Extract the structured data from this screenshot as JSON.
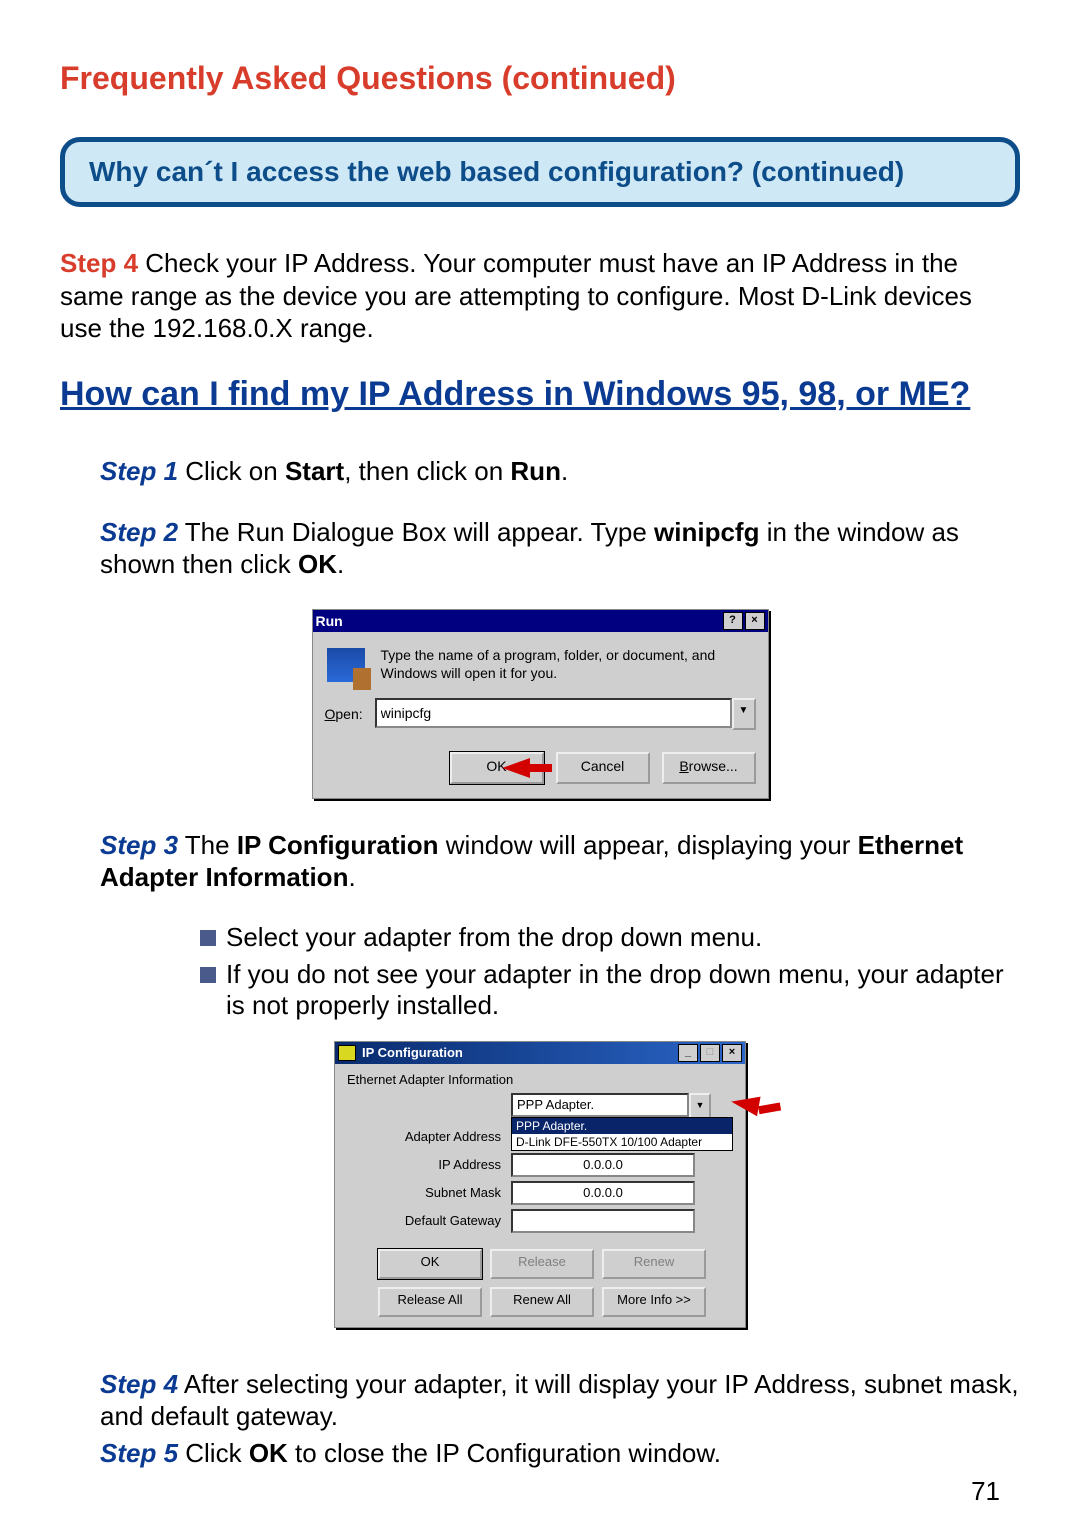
{
  "section_title": "Frequently Asked Questions (continued)",
  "faq_box": "Why can´t I access the web based configuration? (continued)",
  "top_step_label": "Step 4",
  "top_step_text": " Check your IP Address. Your computer must have an IP Address in the same range as the device you are attempting to configure. Most D-Link devices use the 192.168.0.X range.",
  "big_heading": "How can I find my IP Address in Windows 95, 98, or ME?",
  "step1_label": "Step 1",
  "step1_a": " Click on ",
  "step1_b": "Start",
  "step1_c": ", then click on ",
  "step1_d": "Run",
  "step1_e": ".",
  "step2_label": "Step 2",
  "step2_a": " The Run Dialogue Box will appear. Type ",
  "step2_b": "winipcfg",
  "step2_c": " in the window as shown then click ",
  "step2_d": "OK",
  "step2_e": ".",
  "run": {
    "title": "Run",
    "help": "?",
    "close": "×",
    "desc": "Type the name of a program, folder, or document, and Windows will open it for you.",
    "open_underline": "O",
    "open_rest": "pen:",
    "value": "winipcfg",
    "ok": "OK",
    "cancel": "Cancel",
    "browse_underline": "B",
    "browse_rest": "rowse..."
  },
  "step3_label": "Step 3",
  "step3_a": " The ",
  "step3_b": "IP Configuration",
  "step3_c": " window will appear, displaying your ",
  "step3_d": "Ethernet Adapter Information",
  "step3_e": ".",
  "bullets": [
    "Select your adapter from the drop down menu.",
    "If you do not see your adapter in the drop down menu, your adapter is not properly installed."
  ],
  "ip": {
    "title": "IP Configuration",
    "min": "_",
    "max": "□",
    "close": "×",
    "group": "Ethernet Adapter Information",
    "fields": {
      "adapter_selected": "PPP Adapter.",
      "options": [
        "PPP Adapter.",
        "D-Link DFE-550TX 10/100 Adapter"
      ],
      "adapter_address_label": "Adapter Address",
      "adapter_address_value": "",
      "ip_label": "IP Address",
      "ip_value": "0.0.0.0",
      "mask_label": "Subnet Mask",
      "mask_value": "0.0.0.0",
      "gateway_label": "Default Gateway",
      "gateway_value": ""
    },
    "buttons": {
      "ok": "OK",
      "release": "Release",
      "renew": "Renew",
      "release_all": "Release All",
      "renew_all": "Renew All",
      "more": "More Info >>"
    }
  },
  "step4b_label": "Step 4",
  "step4b_text": "   After selecting your adapter, it will display your IP Address, subnet mask, and default gateway.",
  "step5_label": "Step 5",
  "step5_a": "  Click ",
  "step5_b": "OK",
  "step5_c": " to close the IP Configuration window.",
  "page_number": "71"
}
